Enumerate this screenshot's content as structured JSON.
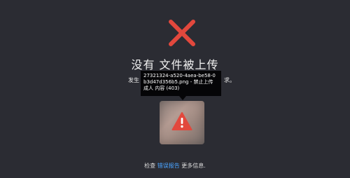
{
  "page": {
    "title": "没有 文件被上传",
    "desc_left": "发生",
    "desc_right": "求。"
  },
  "tooltip": {
    "text": "27321324-a520-4aea-be58-0b3d47d356b5.png - 禁止上传 成人 内容 (403)"
  },
  "footer": {
    "prefix": "检查",
    "link": "错误报告",
    "suffix": "更多信息."
  },
  "colors": {
    "background": "#2b2c33",
    "error_red": "#e2483d",
    "link": "#4aa3ff"
  },
  "icons": {
    "status": "close-x-icon",
    "thumbnail_overlay": "warning-triangle-icon"
  }
}
